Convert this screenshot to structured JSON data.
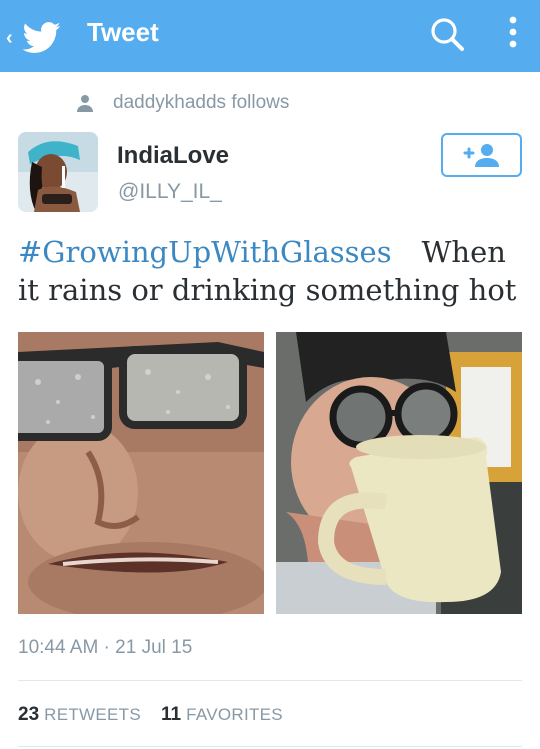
{
  "appbar": {
    "title": "Tweet",
    "back_icon": "twitter-bird-icon",
    "chevron": "‹",
    "color": "#55acee"
  },
  "social_context": {
    "text": "daddykhadds follows",
    "icon": "person-icon"
  },
  "user": {
    "name": "IndiaLove",
    "handle": "@ILLY_IL_",
    "follow_icon": "add-user-icon"
  },
  "tweet": {
    "hashtag": "#GrowingUpWithGlasses",
    "text": "When it rains or drinking something hot",
    "timestamp": "10:44 AM · 21 Jul 15",
    "hashtag_color": "#3b88c3"
  },
  "photos": [
    {
      "name": "foggy-glasses-rain-photo"
    },
    {
      "name": "foggy-glasses-mug-photo"
    }
  ],
  "stats": {
    "retweets_count": "23",
    "retweets_label": "RETWEETS",
    "favorites_count": "11",
    "favorites_label": "FAVORITES"
  }
}
